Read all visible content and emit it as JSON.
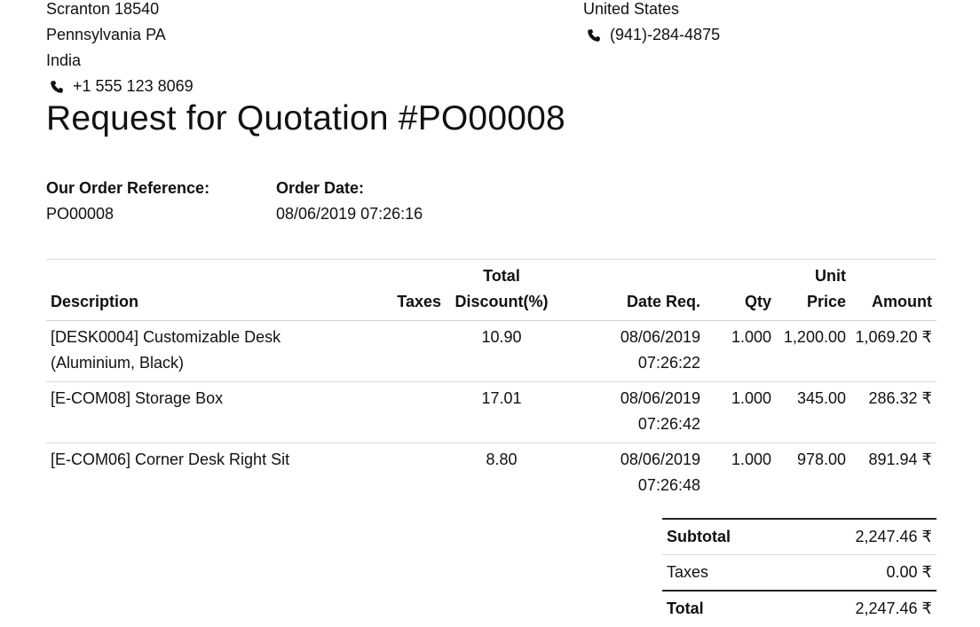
{
  "vendor_address": {
    "lines": [
      "Scranton 18540",
      "Pennsylvania PA",
      "India"
    ],
    "phone": "+1 555 123 8069"
  },
  "shipping_address": {
    "lines": [
      "United States"
    ],
    "phone": "(941)-284-4875"
  },
  "title": "Request for Quotation #PO00008",
  "order_reference": {
    "label": "Our Order Reference:",
    "value": "PO00008"
  },
  "order_date": {
    "label": "Order Date:",
    "value": "08/06/2019 07:26:16"
  },
  "table": {
    "headers": {
      "description": "Description",
      "taxes": "Taxes",
      "discount_top": "Total",
      "discount": "Discount(%)",
      "date_req": "Date Req.",
      "qty": "Qty",
      "unit_price_top": "Unit",
      "unit_price": "Price",
      "amount": "Amount"
    },
    "rows": [
      {
        "description_line1": "[DESK0004] Customizable Desk",
        "description_line2": "(Aluminium, Black)",
        "taxes": "",
        "discount": "10.90",
        "date": "08/06/2019",
        "time": "07:26:22",
        "qty": "1.000",
        "unit_price": "1,200.00",
        "amount": "1,069.20 ₹"
      },
      {
        "description_line1": "[E-COM08] Storage Box",
        "description_line2": "",
        "taxes": "",
        "discount": "17.01",
        "date": "08/06/2019",
        "time": "07:26:42",
        "qty": "1.000",
        "unit_price": "345.00",
        "amount": "286.32 ₹"
      },
      {
        "description_line1": "[E-COM06] Corner Desk Right Sit",
        "description_line2": "",
        "taxes": "",
        "discount": "8.80",
        "date": "08/06/2019",
        "time": "07:26:48",
        "qty": "1.000",
        "unit_price": "978.00",
        "amount": "891.94 ₹"
      }
    ]
  },
  "totals": {
    "subtotal_label": "Subtotal",
    "subtotal": "2,247.46 ₹",
    "taxes_label": "Taxes",
    "taxes": "0.00 ₹",
    "total_label": "Total",
    "total": "2,247.46 ₹"
  }
}
